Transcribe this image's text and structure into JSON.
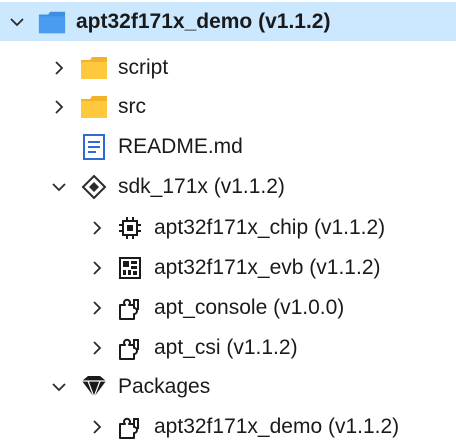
{
  "tree": {
    "root": {
      "label": "apt32f171x_demo (v1.1.2)",
      "expanded": true,
      "icon": "project-folder-icon"
    },
    "script": {
      "label": "script",
      "expanded": false,
      "icon": "folder-icon"
    },
    "src": {
      "label": "src",
      "expanded": false,
      "icon": "folder-icon"
    },
    "readme": {
      "label": "README.md",
      "icon": "document-icon"
    },
    "sdk": {
      "label": "sdk_171x (v1.1.2)",
      "expanded": true,
      "icon": "sdk-diamond-icon"
    },
    "chip": {
      "label": "apt32f171x_chip (v1.1.2)",
      "expanded": false,
      "icon": "chip-icon"
    },
    "evb": {
      "label": "apt32f171x_evb (v1.1.2)",
      "expanded": false,
      "icon": "board-icon"
    },
    "console": {
      "label": "apt_console (v1.0.0)",
      "expanded": false,
      "icon": "component-icon"
    },
    "csi": {
      "label": "apt_csi (v1.1.2)",
      "expanded": false,
      "icon": "component-icon"
    },
    "packages": {
      "label": "Packages",
      "expanded": true,
      "icon": "packages-icon"
    },
    "pkg_demo": {
      "label": "apt32f171x_demo (v1.1.2)",
      "expanded": false,
      "icon": "component-icon"
    }
  },
  "colors": {
    "selection": "#cce8ff",
    "folder": "#ffc83d",
    "project": "#3f8fe0"
  }
}
